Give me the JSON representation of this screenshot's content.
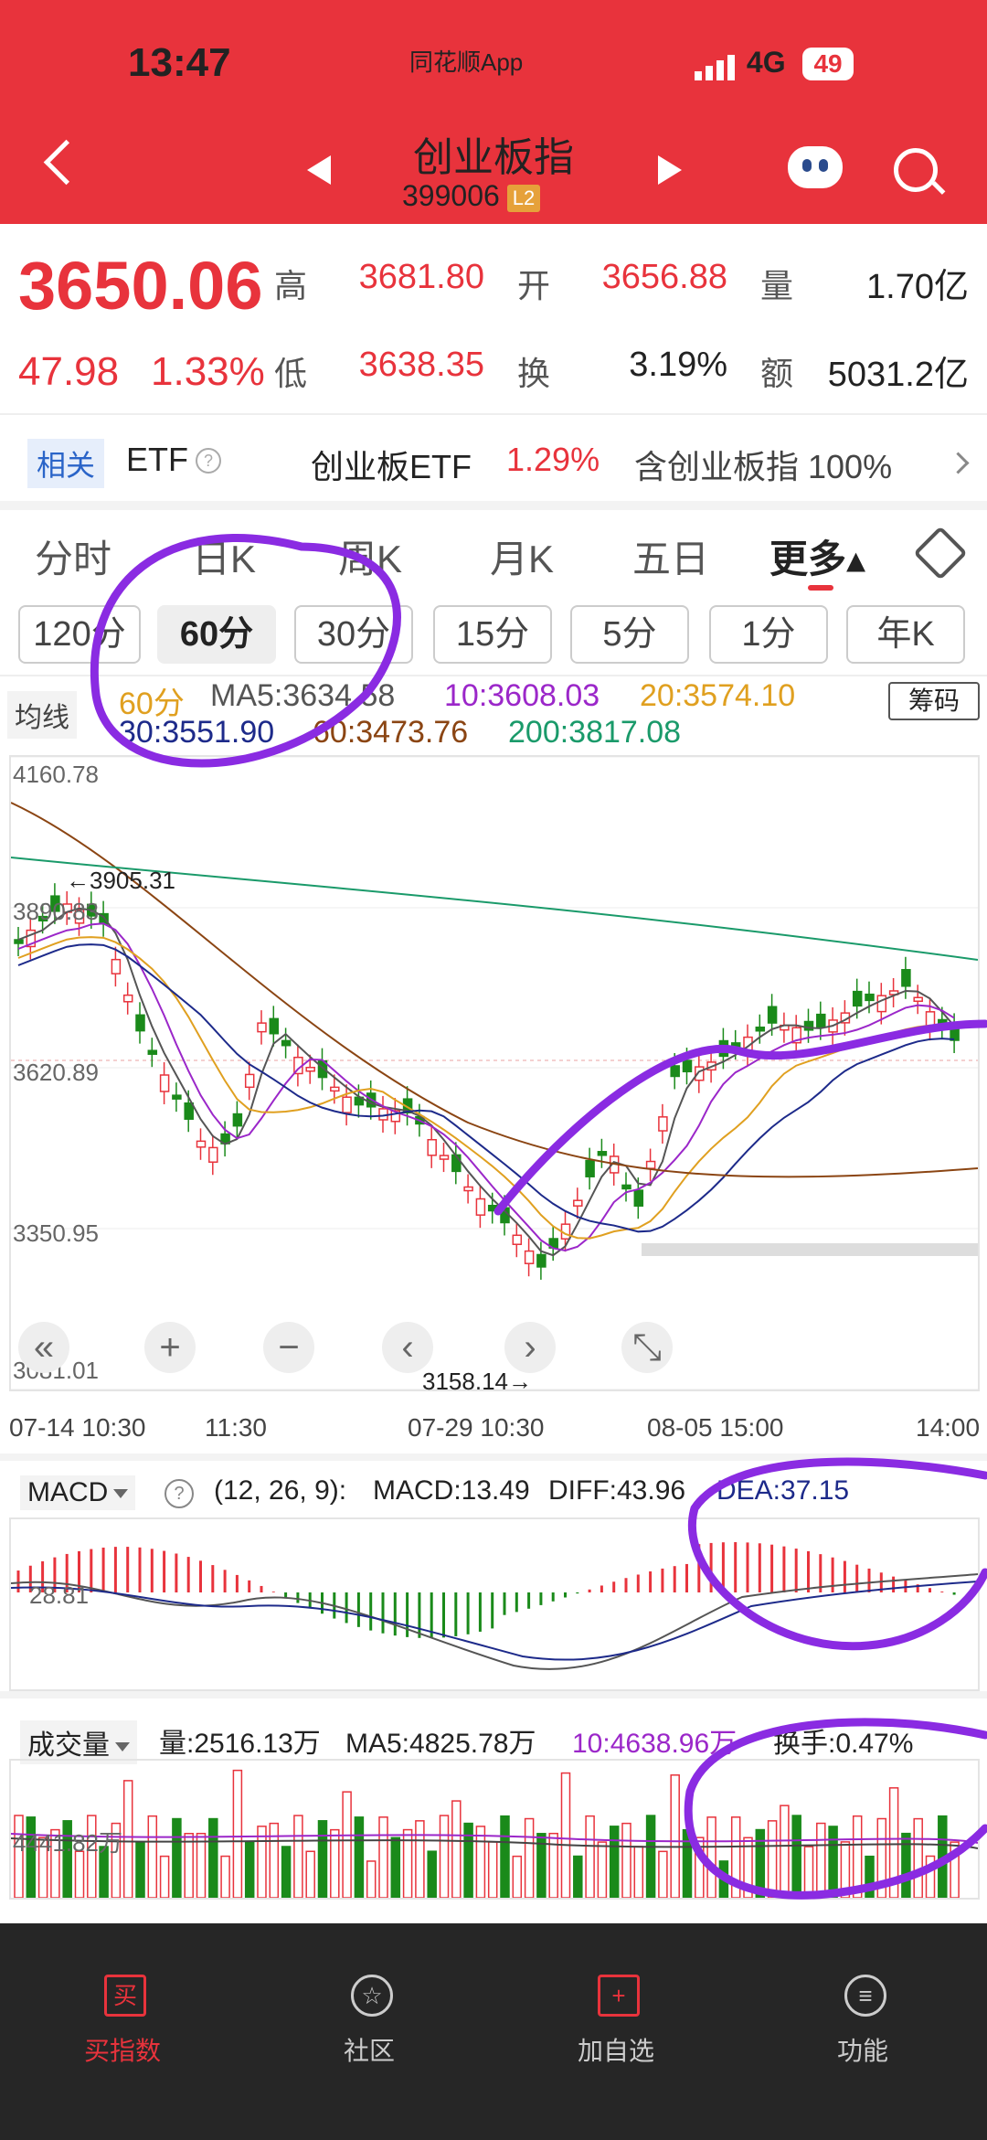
{
  "status": {
    "time": "13:47",
    "app": "同花顺App",
    "network": "4G",
    "battery": "49"
  },
  "header": {
    "title": "创业板指",
    "code": "399006",
    "badge": "L2"
  },
  "quote": {
    "price": "3650.06",
    "change": "47.98",
    "change_pct": "1.33%",
    "high_label": "高",
    "high": "3681.80",
    "open_label": "开",
    "open": "3656.88",
    "vol_label": "量",
    "vol": "1.70亿",
    "low_label": "低",
    "low": "3638.35",
    "turnover_label": "换",
    "turnover": "3.19%",
    "amount_label": "额",
    "amount": "5031.2亿"
  },
  "etf": {
    "tag": "相关",
    "label": "ETF",
    "help": "?",
    "name": "创业板ETF",
    "pct": "1.29%",
    "contains": "含创业板指 100%"
  },
  "tabs": [
    "分时",
    "日K",
    "周K",
    "月K",
    "五日",
    "更多▴"
  ],
  "periods": [
    "120分",
    "60分",
    "30分",
    "15分",
    "5分",
    "1分",
    "年K"
  ],
  "ma": {
    "button": "均线",
    "period": "60分",
    "ma5": "MA5:3634.58",
    "ma10": "10:3608.03",
    "ma20": "20:3574.10",
    "ma30": "30:3551.90",
    "ma60": "60:3473.76",
    "ma200": "200:3817.08",
    "chip": "筹码"
  },
  "kline": {
    "y_labels": [
      "4160.78",
      "3890.83",
      "3620.89",
      "3350.95",
      "3081.01"
    ],
    "high_mark": "←3905.31",
    "low_mark": "3158.14→",
    "x_labels": [
      "07-14 10:30",
      "11:30",
      "07-29 10:30",
      "08-05 15:00",
      "14:00"
    ],
    "controls": [
      "«",
      "+",
      "−",
      "‹",
      "›",
      "⤡"
    ]
  },
  "macd": {
    "label": "MACD",
    "help": "?",
    "params": "(12, 26, 9):",
    "macd": "MACD:13.49",
    "diff": "DIFF:43.96",
    "dea": "DEA:37.15",
    "axis": "28.81"
  },
  "volume": {
    "label": "成交量",
    "vol": "量:2516.13万",
    "ma5": "MA5:4825.78万",
    "ma10": "10:4638.96万",
    "turnover": "换手:0.47%",
    "axis": "4441.82万"
  },
  "nav": [
    {
      "label": "买指数",
      "icon": "buy-icon"
    },
    {
      "label": "社区",
      "icon": "community-icon"
    },
    {
      "label": "加自选",
      "icon": "add-favorite-icon"
    },
    {
      "label": "功能",
      "icon": "menu-icon"
    }
  ],
  "colors": {
    "up": "#e8333c",
    "down": "#1a8a1a",
    "ma5": "#555555",
    "ma10": "#9b27c9",
    "ma20": "#e0a020",
    "ma30": "#1d2a8a",
    "ma60": "#8b4513",
    "ma200": "#1a9a6a",
    "annotation": "#8a2be2"
  }
}
